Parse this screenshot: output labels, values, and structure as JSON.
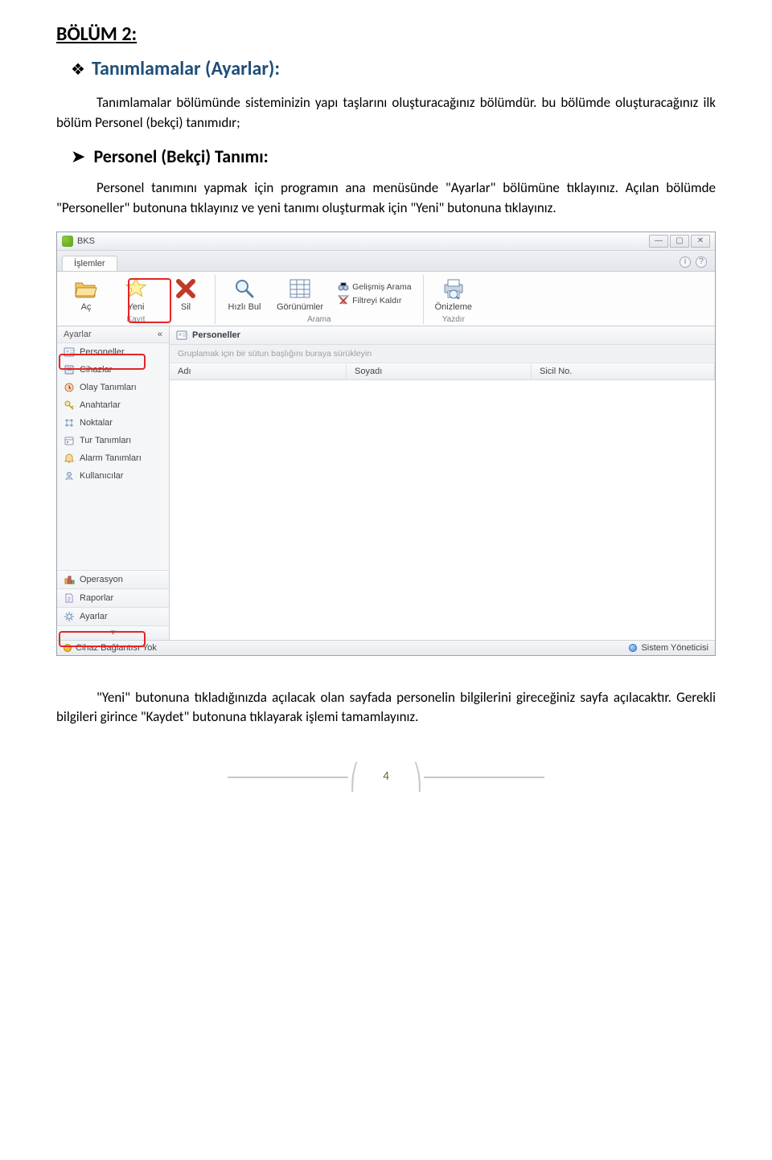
{
  "doc": {
    "section_title": "BÖLÜM 2:",
    "subheading": "Tanımlamalar (Ayarlar):",
    "para1": "Tanımlamalar bölümünde sisteminizin yapı taşlarını oluşturacağınız bölümdür. bu bölümde oluşturacağınız ilk bölüm Personel (bekçi) tanımıdır;",
    "sub_sub": "Personel (Bekçi) Tanımı:",
    "para2": "Personel tanımını yapmak için programın ana menüsünde \"Ayarlar\" bölümüne tıklayınız. Açılan bölümde \"Personeller\" butonuna tıklayınız ve yeni tanımı oluşturmak için \"Yeni\" butonuna tıklayınız.",
    "para3": "\"Yeni\" butonuna tıkladığınızda açılacak  olan sayfada personelin bilgilerini gireceğiniz sayfa açılacaktır. Gerekli bilgileri girince \"Kaydet\" butonuna tıklayarak işlemi tamamlayınız.",
    "page_number": "4"
  },
  "app": {
    "title": "BKS",
    "tab": "İşlemler",
    "toolbar": {
      "ac": "Aç",
      "yeni": "Yeni",
      "sil": "Sil",
      "hizli_bul": "Hızlı Bul",
      "gorunumler": "Görünümler",
      "gelismis_arama": "Gelişmiş Arama",
      "filtreyi_kaldir": "Filtreyi Kaldır",
      "onizleme": "Önizleme"
    },
    "groups": {
      "kayit": "Kayıt",
      "arama": "Arama",
      "yazdir": "Yazdır"
    },
    "sidebar": {
      "header": "Ayarlar",
      "collapse": "«",
      "items": [
        "Personeller",
        "Cihazlar",
        "Olay Tanımları",
        "Anahtarlar",
        "Noktalar",
        "Tur Tanımları",
        "Alarm Tanımları",
        "Kullanıcılar"
      ],
      "bottom": {
        "operasyon": "Operasyon",
        "raporlar": "Raporlar",
        "ayarlar": "Ayarlar"
      }
    },
    "content": {
      "title": "Personeller",
      "group_hint": "Gruplamak için bir sütun başlığını buraya sürükleyin",
      "columns": {
        "adi": "Adı",
        "soyadi": "Soyadı",
        "sicil": "Sicil No."
      }
    },
    "status": {
      "left": "Cihaz Bağlantısı Yok",
      "right": "Sistem Yöneticisi"
    }
  }
}
